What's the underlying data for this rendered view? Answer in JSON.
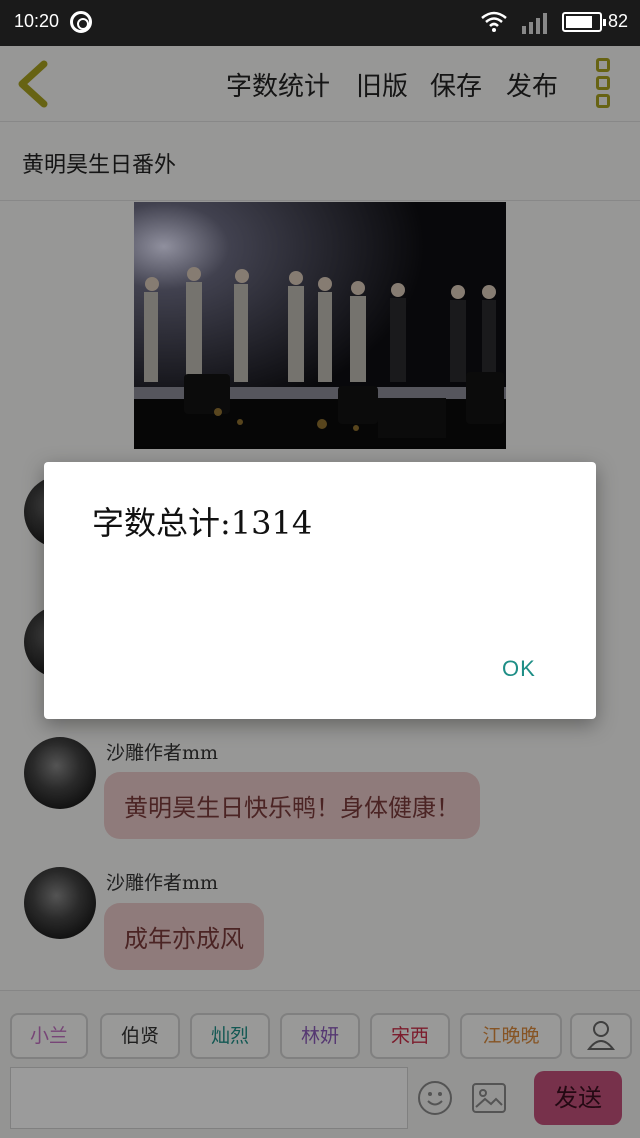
{
  "status_bar": {
    "time": "10:20",
    "battery": "82",
    "battery_level": 0.82
  },
  "header": {
    "word_count_label": "字数统计",
    "old_version_label": "旧版",
    "save_label": "保存",
    "publish_label": "发布"
  },
  "post": {
    "title": "黄明昊生日番外"
  },
  "messages": [
    {
      "sender": "沙雕作者mm",
      "text": "黄明昊生日快乐鸭！身体健康！"
    },
    {
      "sender": "沙雕作者mm",
      "text": "成年亦成风"
    }
  ],
  "characters": [
    {
      "name": "小兰",
      "color": "#c070c0"
    },
    {
      "name": "伯贤",
      "color": "#333333"
    },
    {
      "name": "灿烈",
      "color": "#1e8e86"
    },
    {
      "name": "林妍",
      "color": "#8a5ab8"
    },
    {
      "name": "宋西",
      "color": "#c8304a"
    },
    {
      "name": "江晚晚",
      "color": "#d8883a"
    }
  ],
  "composer": {
    "send_label": "发送"
  },
  "dialog": {
    "message": "字数总计:1314",
    "ok_label": "OK"
  },
  "colors": {
    "accent": "#a6a020",
    "send": "#c0507a",
    "ok": "#1e8e86",
    "bubble": "#e7c7c7"
  }
}
